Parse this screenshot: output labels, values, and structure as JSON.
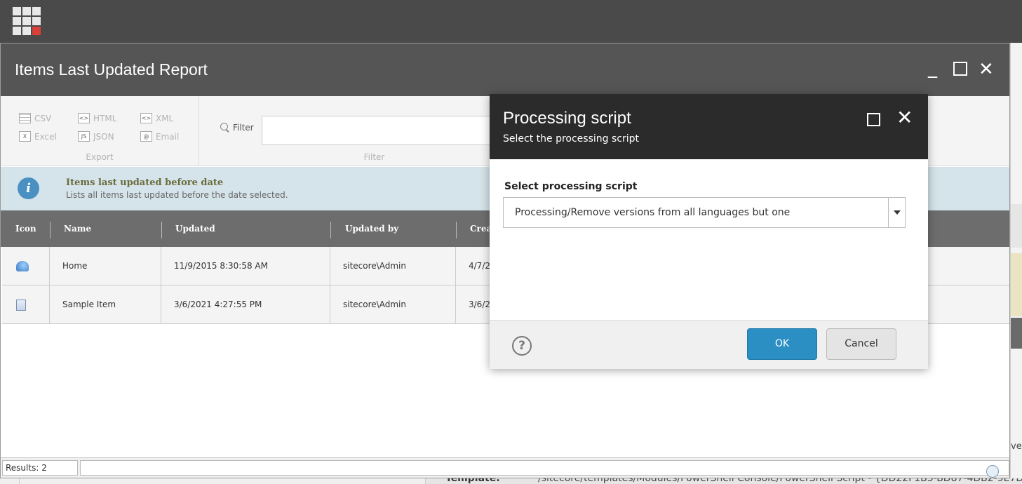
{
  "topbar": {
    "launcher_icon": "app-grid-icon"
  },
  "background": {
    "right_text": "ve",
    "template_label": "Template:",
    "template_value": "/sitecore/templates/Modules/PowerShell Console/PowerShell Script - {DD22F1B3-BD87-4DB2-9E7D"
  },
  "report": {
    "title": "Items Last Updated Report",
    "ribbon": {
      "export": {
        "items": [
          {
            "label": "CSV",
            "icon": "csv-icon"
          },
          {
            "label": "HTML",
            "icon": "html-icon"
          },
          {
            "label": "XML",
            "icon": "xml-icon"
          },
          {
            "label": "Excel",
            "icon": "excel-icon"
          },
          {
            "label": "JSON",
            "icon": "json-icon"
          },
          {
            "label": "Email",
            "icon": "email-icon"
          }
        ],
        "group_label": "Export"
      },
      "filter": {
        "label": "Filter",
        "group_label": "Filter"
      }
    },
    "info": {
      "title": "Items last updated before date",
      "subtitle": "Lists all items last updated before the date selected."
    },
    "grid": {
      "columns": [
        "Icon",
        "Name",
        "Updated",
        "Updated by",
        "Crea"
      ],
      "rows": [
        {
          "icon": "home-icon",
          "name": "Home",
          "updated": "11/9/2015 8:30:58 AM",
          "updated_by": "sitecore\\Admin",
          "created": "4/7/2"
        },
        {
          "icon": "document-icon",
          "name": "Sample Item",
          "updated": "3/6/2021 4:27:55 PM",
          "updated_by": "sitecore\\Admin",
          "created": "3/6/2"
        }
      ]
    },
    "status": {
      "results": "Results: 2"
    }
  },
  "dialog": {
    "title": "Processing script",
    "subtitle": "Select the processing script",
    "field_label": "Select processing script",
    "selected_script": "Processing/Remove versions from all languages but one",
    "ok_label": "OK",
    "cancel_label": "Cancel",
    "help_symbol": "?"
  },
  "colors": {
    "topbar": "#4a4a4a",
    "report_titlebar": "#555555",
    "dialog_header": "#2b2b2b",
    "ok_button": "#2b8fc4",
    "info_banner": "#d5e4ea",
    "launcher_accent": "#d9403a"
  }
}
